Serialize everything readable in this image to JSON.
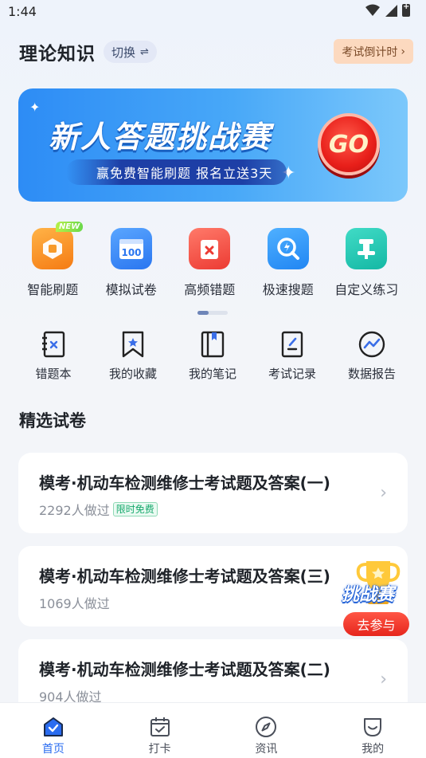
{
  "status_bar": {
    "time": "1:44"
  },
  "header": {
    "title": "理论知识",
    "switch_label": "切换",
    "switch_icon": "⇌",
    "countdown_label": "考试倒计时",
    "countdown_chevron": "›"
  },
  "banner": {
    "title": "新人答题挑战赛",
    "subtitle": "赢免费智能刷题  报名立送3天",
    "go_label": "GO"
  },
  "quick_grid": [
    {
      "label": "智能刷题",
      "icon": "smart-practice-icon",
      "badge": "NEW"
    },
    {
      "label": "模拟试卷",
      "icon": "mock-paper-icon",
      "icon_text": "100"
    },
    {
      "label": "高频错题",
      "icon": "frequent-mistakes-icon"
    },
    {
      "label": "极速搜题",
      "icon": "quick-search-icon"
    },
    {
      "label": "自定义练习",
      "icon": "custom-practice-icon"
    }
  ],
  "tools_grid": [
    {
      "label": "错题本",
      "icon": "mistake-book-icon"
    },
    {
      "label": "我的收藏",
      "icon": "bookmark-icon"
    },
    {
      "label": "我的笔记",
      "icon": "notes-icon"
    },
    {
      "label": "考试记录",
      "icon": "exam-record-icon"
    },
    {
      "label": "数据报告",
      "icon": "data-report-icon"
    }
  ],
  "section": {
    "title": "精选试卷"
  },
  "papers": [
    {
      "title": "模考·机动车检测维修士考试题及答案(一)",
      "count": "2292人做过",
      "tag": "限时免费"
    },
    {
      "title": "模考·机动车检测维修士考试题及答案(三)",
      "count": "1069人做过"
    },
    {
      "title": "模考·机动车检测维修士考试题及答案(二)",
      "count": "904人做过"
    }
  ],
  "float_challenge": {
    "title": "挑战赛",
    "button": "去参与"
  },
  "tab_bar": [
    {
      "label": "首页",
      "icon": "home-icon",
      "active": true
    },
    {
      "label": "打卡",
      "icon": "calendar-check-icon"
    },
    {
      "label": "资讯",
      "icon": "compass-icon"
    },
    {
      "label": "我的",
      "icon": "profile-icon"
    }
  ],
  "colors": {
    "accent": "#2a6cf0",
    "banner": "#2d8cf5",
    "go": "#e81f1a",
    "free_tag": "#15a86b"
  }
}
